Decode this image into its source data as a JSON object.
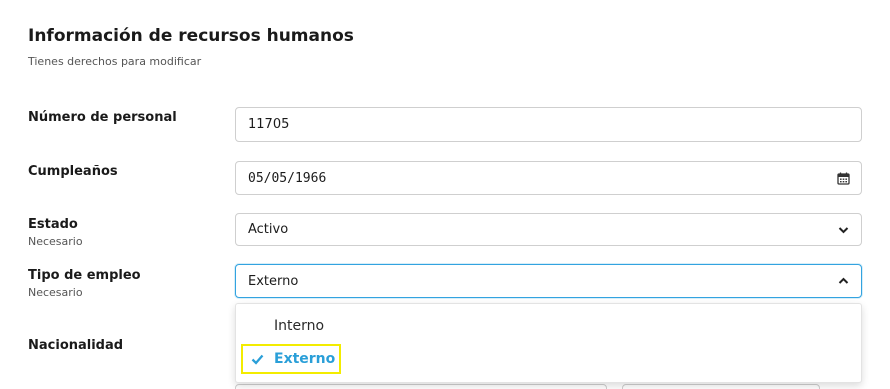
{
  "section": {
    "title": "Información de recursos humanos",
    "subtitle": "Tienes derechos para modificar"
  },
  "fields": {
    "personnel_number": {
      "label": "Número de personal",
      "value": "11705"
    },
    "birthday": {
      "label": "Cumpleaños",
      "value": "05/05/1966",
      "icon": "calendar-icon"
    },
    "status": {
      "label": "Estado",
      "hint": "Necesario",
      "value": "Activo",
      "icon": "chevron-down-icon"
    },
    "employment_type": {
      "label": "Tipo de empleo",
      "hint": "Necesario",
      "value": "Externo",
      "icon": "chevron-up-icon"
    },
    "nationality": {
      "label": "Nacionalidad"
    }
  },
  "employment_type_options": [
    {
      "label": "Interno",
      "selected": false
    },
    {
      "label": "Externo",
      "selected": true,
      "icon": "checkmark-icon"
    }
  ],
  "colors": {
    "focus_border": "#33a3e0",
    "selected_option": "#2a9fd8",
    "highlight_box": "#f3ec00"
  }
}
